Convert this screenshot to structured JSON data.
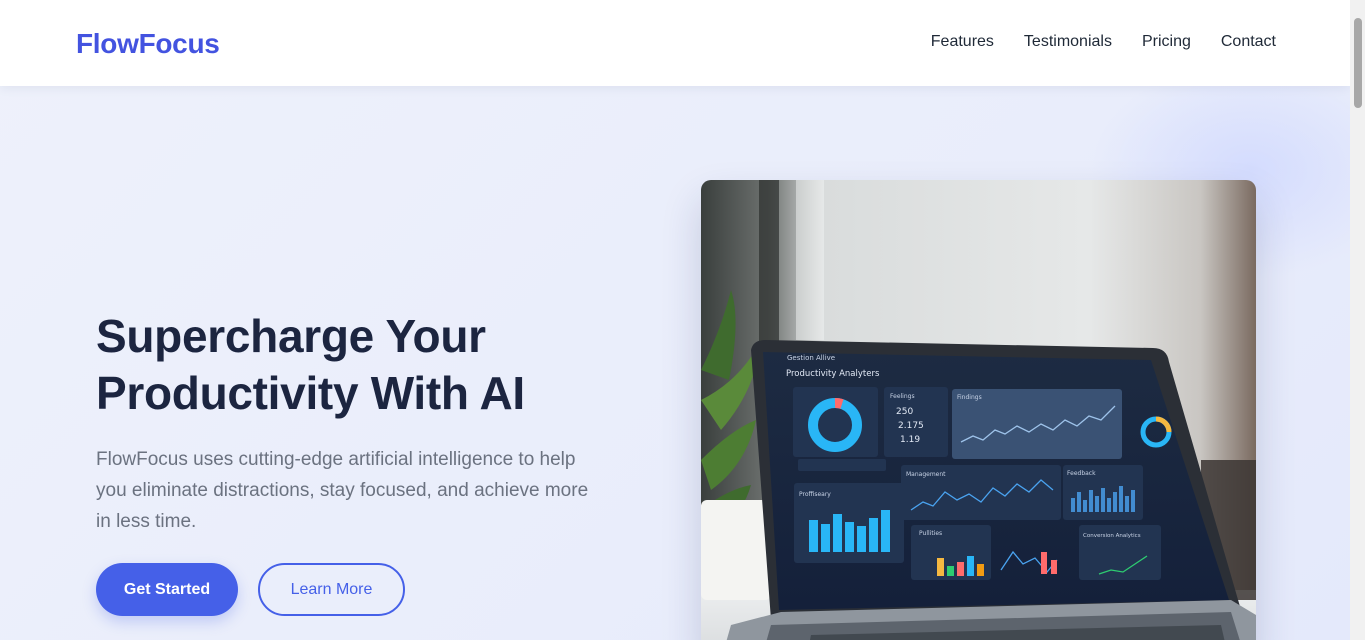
{
  "brand": {
    "name": "FlowFocus"
  },
  "nav": {
    "items": [
      "Features",
      "Testimonials",
      "Pricing",
      "Contact"
    ]
  },
  "hero": {
    "title_line1": "Supercharge Your",
    "title_line2": "Productivity With AI",
    "description": "FlowFocus uses cutting-edge artificial intelligence to help you eliminate distractions, stay focused, and achieve more in less time.",
    "primary_cta": "Get Started",
    "secondary_cta": "Learn More"
  },
  "dashboard_screen": {
    "app_name": "Gestion Allive",
    "page_title": "Productivity Analyters",
    "stats_title": "Feelings",
    "stats": [
      "250",
      "2.175",
      "1.19"
    ],
    "trend_title": "Findings",
    "panel_management": "Management",
    "panel_feedback": "Feedback",
    "panel_productivity": "Proffiseary",
    "panel_analytics": "Pullities",
    "panel_conversion": "Conversion Analytics"
  },
  "colors": {
    "brand": "#4353e0",
    "primary": "#4560e8",
    "heading": "#1c2540",
    "body_text": "#6b7280"
  }
}
